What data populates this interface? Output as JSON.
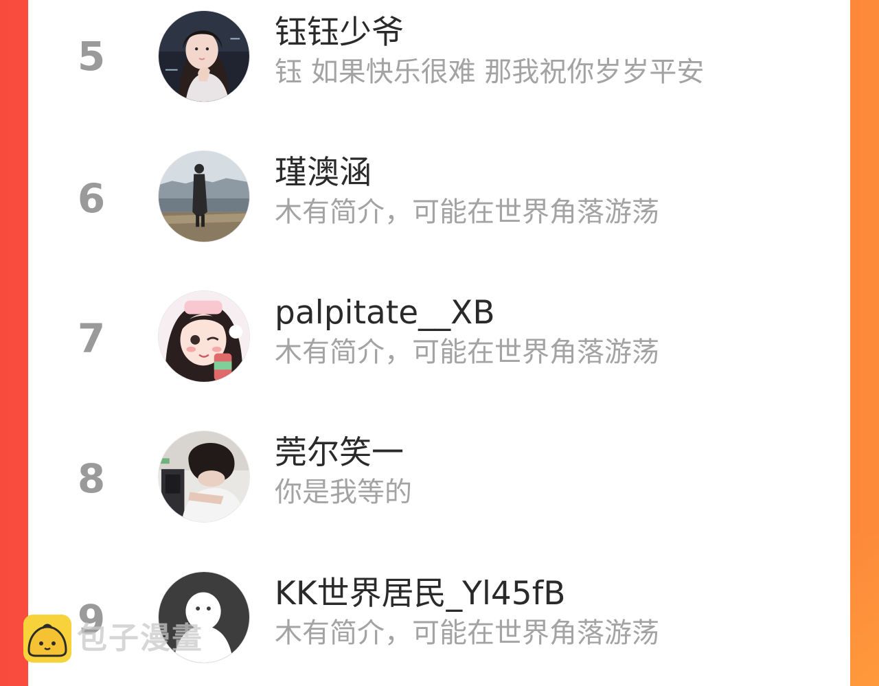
{
  "list": {
    "items": [
      {
        "rank": "5",
        "name": "钰钰少爷",
        "bio": "钰 如果快乐很难 那我祝你岁岁平安"
      },
      {
        "rank": "6",
        "name": "瑾澳涵",
        "bio": "木有简介，可能在世界角落游荡"
      },
      {
        "rank": "7",
        "name": "palpitate__XB",
        "bio": "木有简介，可能在世界角落游荡"
      },
      {
        "rank": "8",
        "name": "莞尔笑一",
        "bio": "你是我等的"
      },
      {
        "rank": "9",
        "name": "KK世界居民_Yl45fB",
        "bio": "木有简介，可能在世界角落游荡"
      }
    ]
  },
  "watermark": {
    "text": "包子漫畫",
    "logo_icon": "bun-mascot-icon"
  },
  "colors": {
    "background_left": "#f94a3e",
    "background_right": "#fd8a3a",
    "panel": "#ffffff",
    "rank": "#9a9a9a",
    "name": "#2a2a2a",
    "bio": "#a3a3a3",
    "logo": "#f7d23a"
  }
}
